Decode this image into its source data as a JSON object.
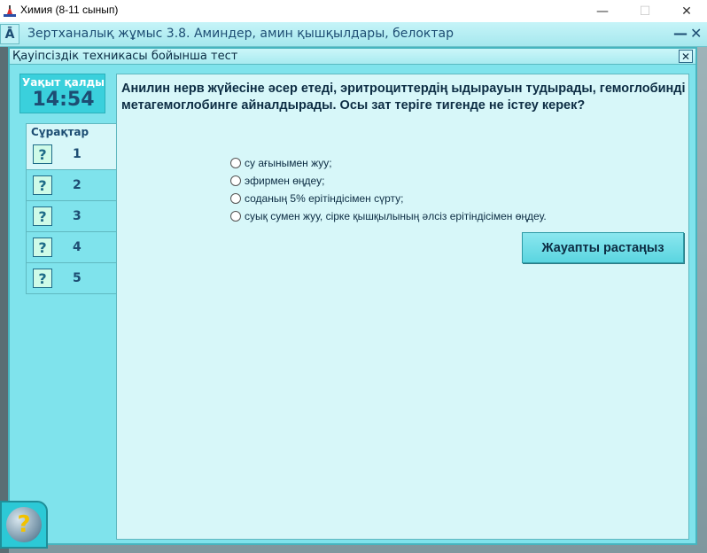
{
  "window": {
    "title": "Химия (8-11 сынып)",
    "minimize": "—",
    "maximize": "☐",
    "close": "✕"
  },
  "appbar": {
    "title": "Зертханалық жұмыс 3.8. Аминдер, амин қышқылдары, белоктар",
    "icon": "Ā",
    "minimize": "—",
    "close": "✕"
  },
  "dialog": {
    "title": "Қауіпсіздік техникасы бойынша тест",
    "close": "✕"
  },
  "timer": {
    "label": "Уақыт қалды",
    "value": "14:54"
  },
  "questions": {
    "tab_label": "Сұрақтар",
    "items": [
      {
        "num": "1",
        "icon": "?"
      },
      {
        "num": "2",
        "icon": "?"
      },
      {
        "num": "3",
        "icon": "?"
      },
      {
        "num": "4",
        "icon": "?"
      },
      {
        "num": "5",
        "icon": "?"
      }
    ]
  },
  "question": {
    "text": "Анилин нерв жүйесіне әсер етеді, эритроциттердің ыдырауын тудырады, гемоглобинді метагемоглобинге айналдырады. Осы зат теріге тигенде не істеу керек?",
    "answers": [
      "су ағынымен жуу;",
      "эфирмен өңдеу;",
      "соданың 5% ерітіндісімен сүрту;",
      "суық сумен жуу, сірке қышқылының әлсіз ерітіндісімен өңдеу."
    ],
    "confirm_label": "Жауапты растаңыз"
  },
  "help": {
    "icon": "?"
  }
}
